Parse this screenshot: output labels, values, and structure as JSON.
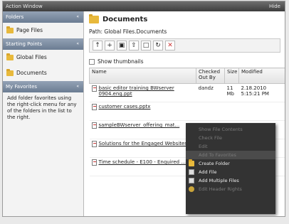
{
  "titlebar": {
    "left": "Action Window",
    "right": "Hide"
  },
  "sidebar": {
    "sections": [
      {
        "header": "Folders",
        "items": [
          "Page Files"
        ]
      },
      {
        "header": "Starting Points",
        "items": [
          "Global Files",
          "Documents"
        ]
      },
      {
        "header": "My Favorites",
        "note": "Add folder favorites using the right-click menu for any of the folders in the list to the right."
      }
    ]
  },
  "main": {
    "title": "Documents",
    "path": "Path: Global Files.Documents",
    "show_thumbnails": "Show thumbnails",
    "columns": [
      "Name",
      "Checked Out By",
      "Size",
      "Modified"
    ],
    "rows": [
      {
        "name": "basic editor training BWserver 0904.eng.ppt",
        "checked_out_by": "dandz",
        "size": "11 Mb",
        "modified": "2.18.2010 5:15:21 PM"
      },
      {
        "name": "customer cases.pptx",
        "checked_out_by": "",
        "size": "",
        "modified": ""
      },
      {
        "name": "sampleBWserver_offering_mat...",
        "checked_out_by": "",
        "size": "",
        "modified": ""
      },
      {
        "name": "Solutions for the Engaged Websites",
        "checked_out_by": "",
        "size": "",
        "modified": ""
      },
      {
        "name": "Time schedule - E100 - Enquired ...",
        "checked_out_by": "",
        "size": "",
        "modified": ""
      }
    ]
  },
  "context_menu": {
    "items": [
      {
        "label": "Show File Contents",
        "enabled": false,
        "icon": ""
      },
      {
        "label": "Check File",
        "enabled": false,
        "icon": ""
      },
      {
        "label": "Edit",
        "enabled": false,
        "icon": ""
      },
      {
        "label": "Add To Favorites",
        "enabled": false,
        "icon": "",
        "selected": true
      },
      {
        "label": "Create Folder",
        "enabled": true,
        "icon": "folder-icon"
      },
      {
        "label": "Add File",
        "enabled": true,
        "icon": "file-add-icon"
      },
      {
        "label": "Add Multiple Files",
        "enabled": true,
        "icon": "files-add-icon"
      },
      {
        "label": "Edit Header Rights",
        "enabled": false,
        "icon": "key-icon"
      }
    ]
  },
  "colors": {
    "sidebar_header": "#7b8ba0",
    "menu_bg": "#333333",
    "folder": "#e8b93c"
  }
}
